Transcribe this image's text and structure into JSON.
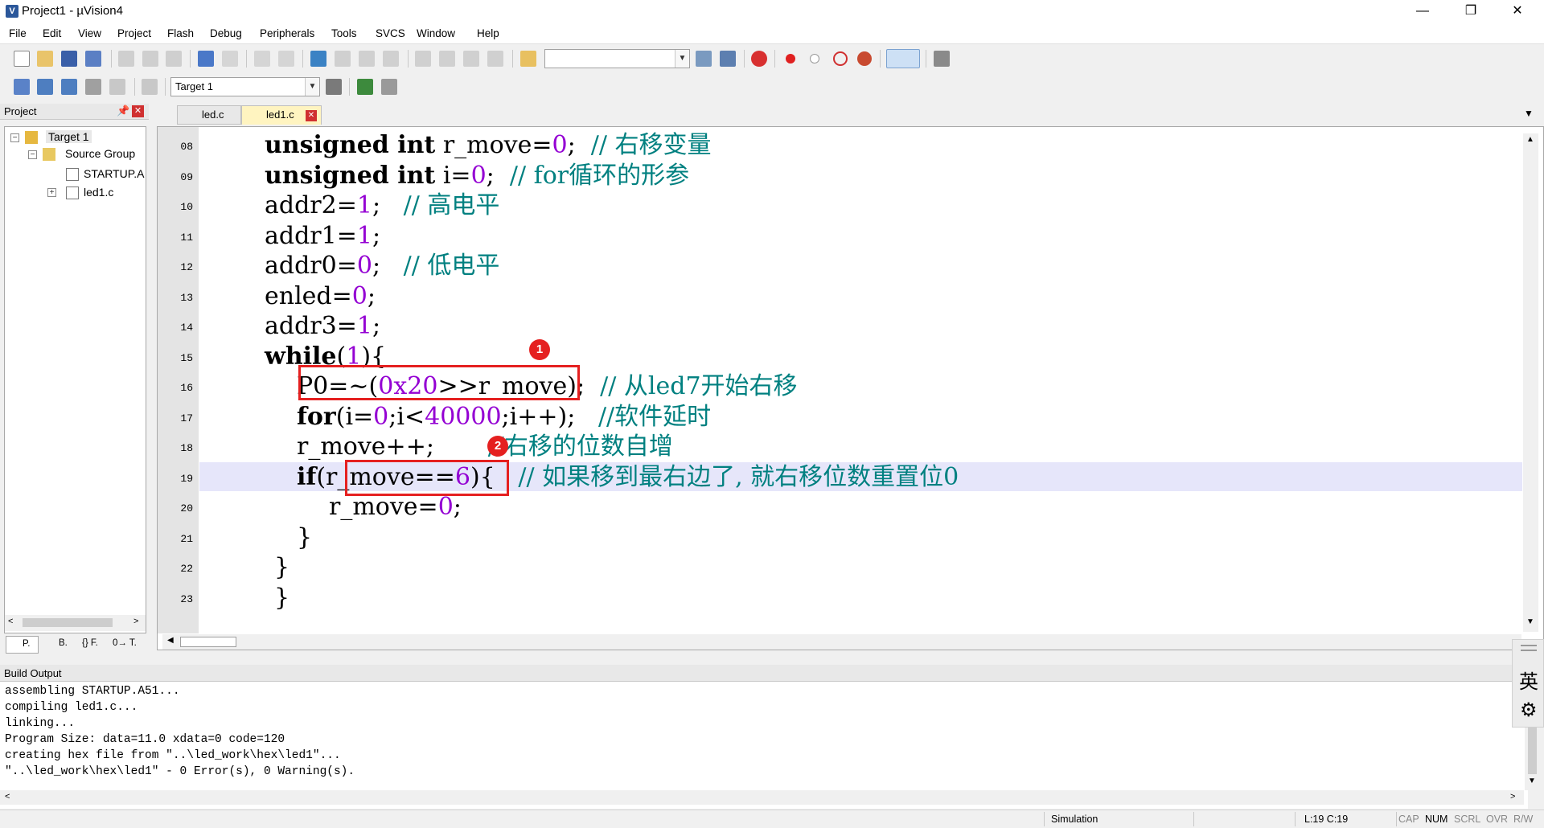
{
  "window": {
    "title": "Project1 - µVision4",
    "app_icon_letter": "V",
    "minimize": "—",
    "restore": "❐",
    "close": "✕"
  },
  "menu": [
    "File",
    "Edit",
    "View",
    "Project",
    "Flash",
    "Debug",
    "Peripherals",
    "Tools",
    "SVCS",
    "Window",
    "Help"
  ],
  "toolbar2": {
    "target": "Target 1"
  },
  "project_panel": {
    "title": "Project",
    "tree": [
      {
        "label": "Target 1",
        "level": 0
      },
      {
        "label": "Source Group",
        "level": 1
      },
      {
        "label": "STARTUP.A",
        "level": 2
      },
      {
        "label": "led1.c",
        "level": 2
      }
    ],
    "bottom_tabs": [
      "P.",
      "B.",
      "{} F.",
      "0→ T."
    ]
  },
  "tabs": [
    {
      "label": "led.c",
      "active": false
    },
    {
      "label": "led1.c",
      "active": true
    }
  ],
  "editor": {
    "lines": [
      {
        "num": "08",
        "indent": 0,
        "parts": [
          [
            "kw",
            "unsigned int"
          ],
          [
            "t",
            " r_move="
          ],
          [
            "num",
            "0"
          ],
          [
            "t",
            ";  "
          ],
          [
            "cm",
            "// 右移变量"
          ]
        ]
      },
      {
        "num": "09",
        "indent": 0,
        "parts": [
          [
            "kw",
            "unsigned int"
          ],
          [
            "t",
            " i="
          ],
          [
            "num",
            "0"
          ],
          [
            "t",
            ";  "
          ],
          [
            "cm",
            "// for循环的形参"
          ]
        ]
      },
      {
        "num": "10",
        "indent": 0,
        "parts": [
          [
            "t",
            "addr2="
          ],
          [
            "num",
            "1"
          ],
          [
            "t",
            ";   "
          ],
          [
            "cm",
            "// 高电平"
          ]
        ]
      },
      {
        "num": "11",
        "indent": 0,
        "parts": [
          [
            "t",
            "addr1="
          ],
          [
            "num",
            "1"
          ],
          [
            "t",
            ";"
          ]
        ]
      },
      {
        "num": "12",
        "indent": 0,
        "parts": [
          [
            "t",
            "addr0="
          ],
          [
            "num",
            "0"
          ],
          [
            "t",
            ";   "
          ],
          [
            "cm",
            "// 低电平"
          ]
        ]
      },
      {
        "num": "13",
        "indent": 0,
        "parts": [
          [
            "t",
            "enled="
          ],
          [
            "num",
            "0"
          ],
          [
            "t",
            ";"
          ]
        ]
      },
      {
        "num": "14",
        "indent": 0,
        "parts": [
          [
            "t",
            "addr3="
          ],
          [
            "num",
            "1"
          ],
          [
            "t",
            ";"
          ]
        ]
      },
      {
        "num": "15",
        "indent": 0,
        "parts": [
          [
            "kw",
            "while"
          ],
          [
            "t",
            "("
          ],
          [
            "num",
            "1"
          ],
          [
            "t",
            "){"
          ]
        ]
      },
      {
        "num": "16",
        "indent": 1,
        "parts": [
          [
            "t",
            "P0=~("
          ],
          [
            "num",
            "0x20"
          ],
          [
            "t",
            ">>r_move);  "
          ],
          [
            "cm",
            "// 从led7开始右移"
          ]
        ]
      },
      {
        "num": "17",
        "indent": 1,
        "parts": [
          [
            "kw",
            "for"
          ],
          [
            "t",
            "(i="
          ],
          [
            "num",
            "0"
          ],
          [
            "t",
            ";i<"
          ],
          [
            "num",
            "40000"
          ],
          [
            "t",
            ";i++);   "
          ],
          [
            "cm",
            "//软件延时"
          ]
        ]
      },
      {
        "num": "18",
        "indent": 1,
        "parts": [
          [
            "t",
            "r_move++;       "
          ],
          [
            "cm",
            "//右移的位数自增"
          ]
        ]
      },
      {
        "num": "19",
        "indent": 1,
        "parts": [
          [
            "kw",
            "if"
          ],
          [
            "t",
            "(r_move=="
          ],
          [
            "num",
            "6"
          ],
          [
            "t",
            "){   "
          ],
          [
            "cm",
            "// 如果移到最右边了, 就右移位数重置位0"
          ]
        ]
      },
      {
        "num": "20",
        "indent": 2,
        "parts": [
          [
            "t",
            "r_move="
          ],
          [
            "num",
            "0"
          ],
          [
            "t",
            ";"
          ]
        ]
      },
      {
        "num": "21",
        "indent": 1,
        "parts": [
          [
            "t",
            "}"
          ]
        ]
      },
      {
        "num": "22",
        "indent": 0.3,
        "parts": [
          [
            "t",
            "}"
          ]
        ]
      },
      {
        "num": "23",
        "indent": 0.3,
        "parts": [
          [
            "t",
            "}"
          ]
        ]
      }
    ],
    "annotations": [
      "1",
      "2"
    ]
  },
  "build_output": {
    "title": "Build Output",
    "lines": [
      "assembling STARTUP.A51...",
      "compiling led1.c...",
      "linking...",
      "Program Size: data=11.0 xdata=0 code=120",
      "creating hex file from \"..\\led_work\\hex\\led1\"...",
      "\"..\\led_work\\hex\\led1\" - 0 Error(s), 0 Warning(s)."
    ]
  },
  "ime": {
    "lang": "英",
    "settings": "⚙"
  },
  "status": {
    "mode": "Simulation",
    "position": "L:19 C:19",
    "cap": "CAP",
    "num": "NUM",
    "scrl": "SCRL",
    "ovr": "OVR",
    "rw": "R/W"
  }
}
